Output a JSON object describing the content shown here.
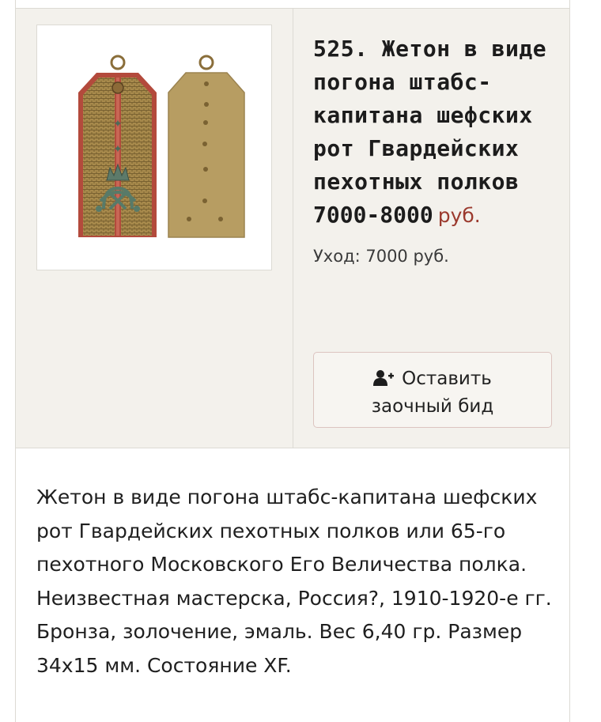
{
  "lot": {
    "title": "525. Жетон в виде погона штабс-капитана шефских рот Гвардейских пехотных полков",
    "estimate": "7000-8000",
    "currency": "руб.",
    "sold_label": "Уход: 7000 руб.",
    "bid_button": {
      "icon": "user-plus-icon",
      "line1": "Оставить",
      "line2": "заочный бид"
    },
    "image_alt": "Жетон — лицевая и оборотная стороны"
  },
  "description": "Жетон в виде погона штабс-капитана шефских рот Гвардейских пехотных полков или 65-го пехотного Московского Его Величества полка. Неизвестная мастерска, Россия?, 1910-1920-е гг. Бронза, золочение, эмаль. Вес 6,40 гр. Размер 34х15 мм. Состояние XF.",
  "colors": {
    "price_accent": "#9b3a2e",
    "panel_bg": "#f3f1ec",
    "border": "#dcdad4"
  }
}
